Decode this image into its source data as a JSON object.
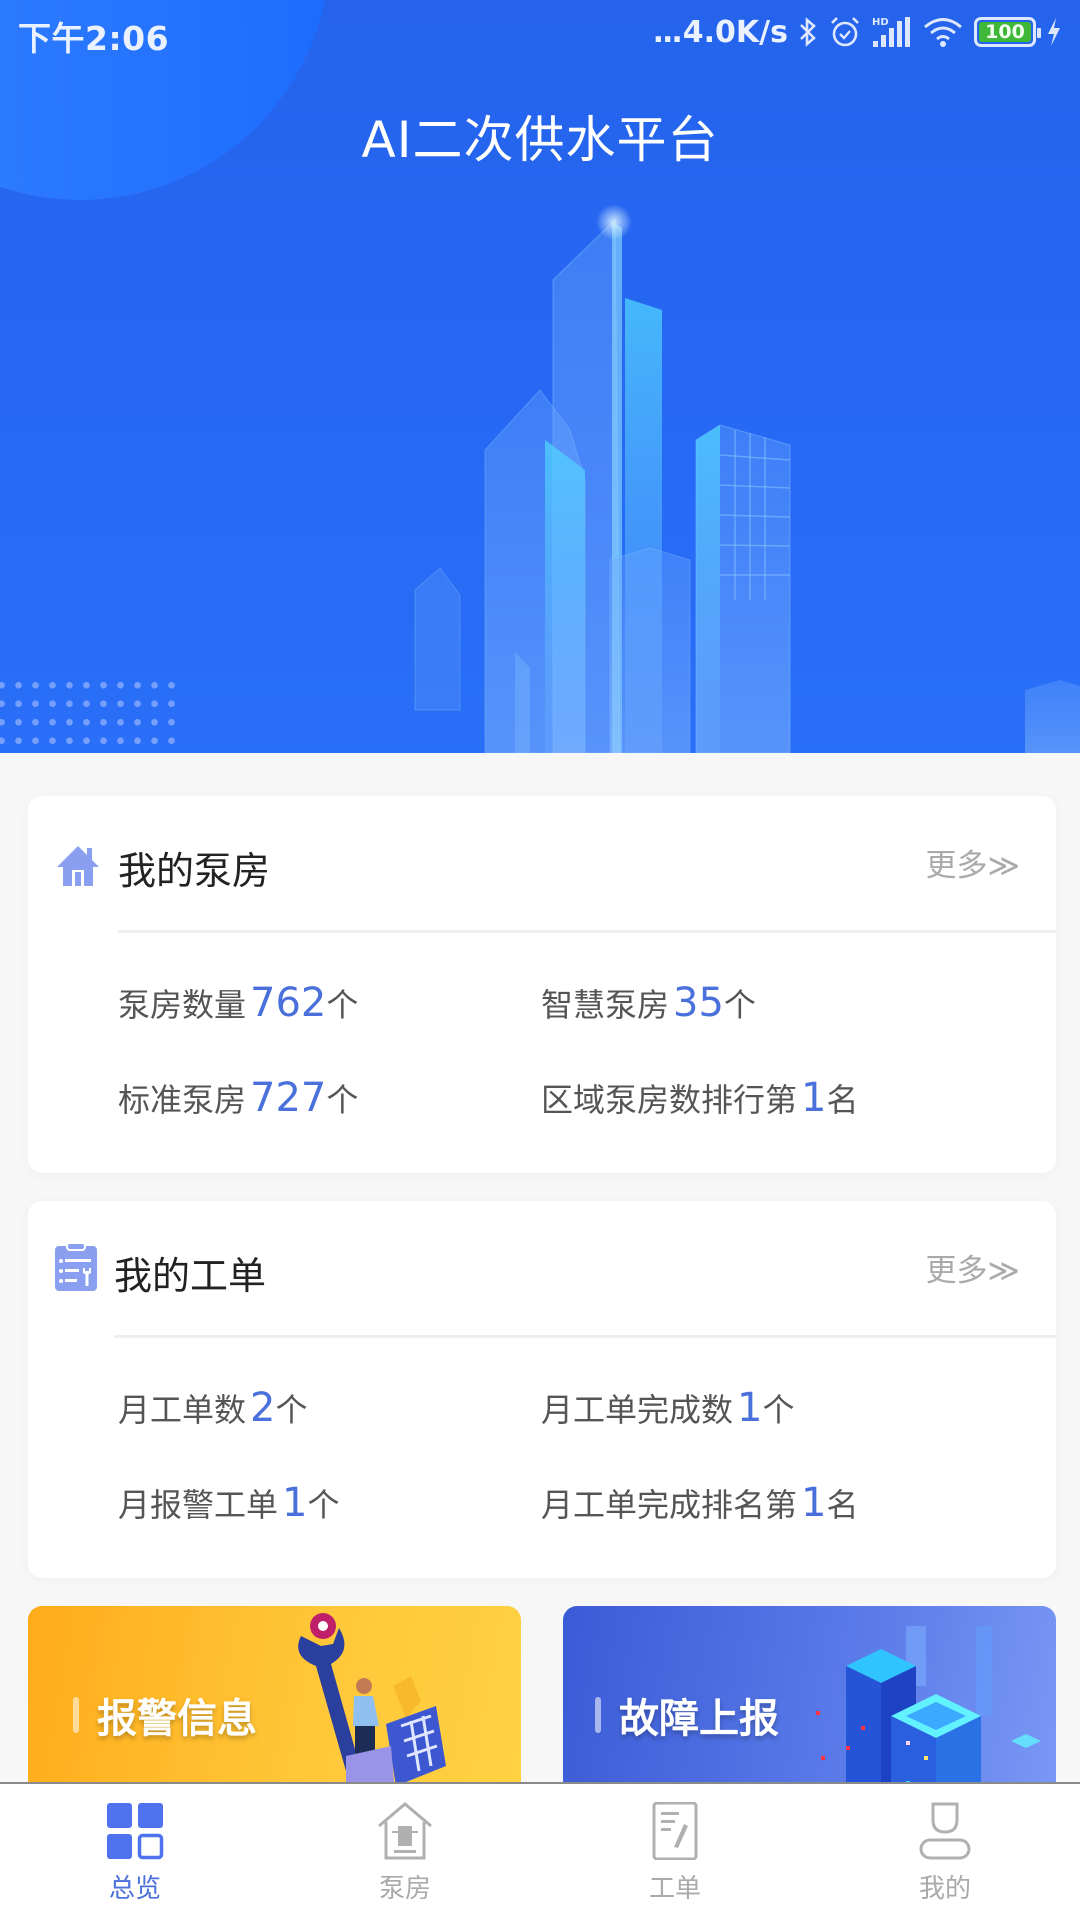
{
  "status_bar": {
    "time": "下午2:06",
    "net_speed_dots": "...",
    "net_speed": "4.0K/s",
    "signal_label": "HD",
    "battery": "100"
  },
  "header": {
    "title": "AI二次供水平台"
  },
  "pump_card": {
    "title": "我的泵房",
    "more": "更多≫",
    "icon": "house-icon",
    "stats": [
      {
        "label": "泵房数量",
        "value": "762",
        "unit": "个"
      },
      {
        "label": "智慧泵房",
        "value": "35",
        "unit": "个"
      },
      {
        "label": "标准泵房",
        "value": "727",
        "unit": "个"
      },
      {
        "label": "区域泵房数排行第",
        "value": "1",
        "unit": "名"
      }
    ]
  },
  "order_card": {
    "title": "我的工单",
    "more": "更多≫",
    "icon": "clipboard-wrench-icon",
    "stats": [
      {
        "label": "月工单数",
        "value": "2",
        "unit": "个"
      },
      {
        "label": "月工单完成数",
        "value": "1",
        "unit": "个"
      },
      {
        "label": "月报警工单",
        "value": "1",
        "unit": "个"
      },
      {
        "label": "月工单完成排名第",
        "value": "1",
        "unit": "名"
      }
    ]
  },
  "promos": [
    {
      "label": "报警信息",
      "color": "#ffb825"
    },
    {
      "label": "故障上报",
      "color": "#4a6ae0"
    }
  ],
  "bottom_nav": {
    "active_color": "#4a70db",
    "inactive_color": "#aaaaaa",
    "items": [
      {
        "label": "总览",
        "icon": "grid-icon",
        "active": true
      },
      {
        "label": "泵房",
        "icon": "pump-house-icon",
        "active": false
      },
      {
        "label": "工单",
        "icon": "work-order-icon",
        "active": false
      },
      {
        "label": "我的",
        "icon": "user-icon",
        "active": false
      }
    ]
  }
}
